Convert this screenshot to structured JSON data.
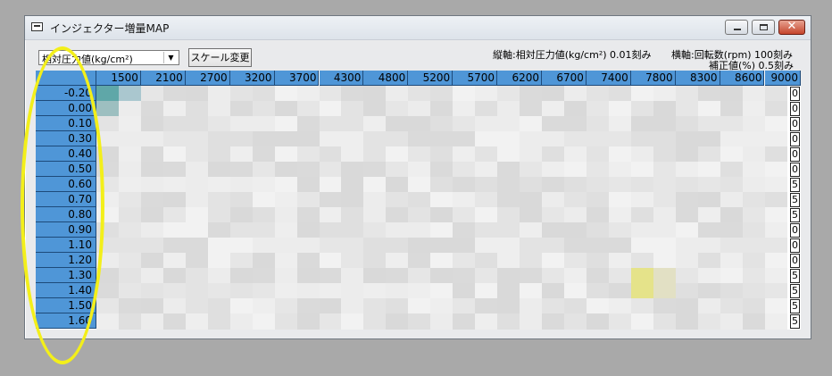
{
  "window": {
    "title": "インジェクター増量MAP"
  },
  "toolbar": {
    "combo_value": "相対圧力値(kg/cm²)",
    "scale_button": "スケール変更",
    "vertical_axis_info": "縦軸:相対圧力値(kg/cm²) 0.01刻み",
    "horizontal_axis_info": "横軸:回転数(rpm) 100刻み",
    "correction_info": "補正値(%) 0.5刻み"
  },
  "table": {
    "columns": [
      "1500",
      "2100",
      "2700",
      "3200",
      "3700",
      "4300",
      "4800",
      "5200",
      "5700",
      "6200",
      "6700",
      "7400",
      "7800",
      "8300",
      "8600",
      "9000"
    ],
    "rows": [
      "-0.20",
      "0.00",
      "0.10",
      "0.30",
      "0.40",
      "0.50",
      "0.60",
      "0.70",
      "0.80",
      "0.90",
      "1.10",
      "1.20",
      "1.30",
      "1.40",
      "1.50",
      "1.60"
    ],
    "last_col_values": [
      "0",
      "0",
      "0",
      "0",
      "0",
      "0",
      "5",
      "5",
      "5",
      "0",
      "0",
      "0",
      "5",
      "5",
      "5",
      "5"
    ]
  }
}
